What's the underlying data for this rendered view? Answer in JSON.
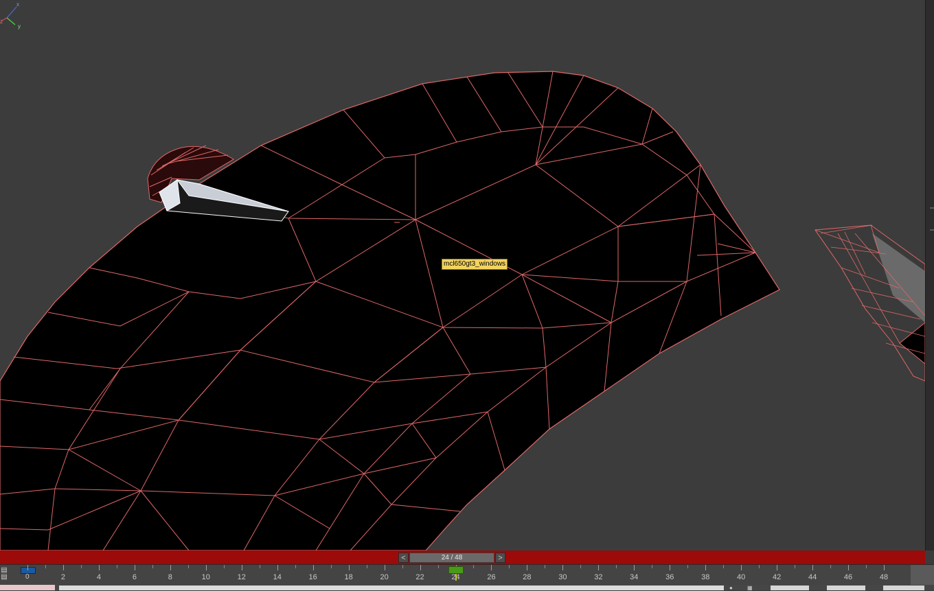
{
  "viewport": {
    "object_label": "mcl650gt3_windows",
    "axis_labels": [
      "x",
      "y",
      "z"
    ]
  },
  "time_slider": {
    "prev_label": "<",
    "next_label": ">",
    "position_text": "24 / 48",
    "current_frame": 24,
    "total_frames": 48
  },
  "trackbar": {
    "zero_label": "0",
    "tick_labels": [
      "2",
      "4",
      "6",
      "8",
      "10",
      "12",
      "14",
      "16",
      "18",
      "20",
      "22",
      "24",
      "26",
      "28",
      "30",
      "32",
      "34",
      "36",
      "38",
      "40",
      "42",
      "44",
      "46",
      "48"
    ],
    "left_tool_icon": "mini-curve-editor-icon"
  },
  "status": {
    "icons": [
      "locate-icon",
      "grid-icon"
    ]
  },
  "colors": {
    "viewport_bg": "#3c3c3c",
    "mesh_fill": "#000000",
    "wire_color": "#e06868",
    "time_slider_bar": "#9c0a0a",
    "tooltip_bg": "#f2d35f"
  }
}
